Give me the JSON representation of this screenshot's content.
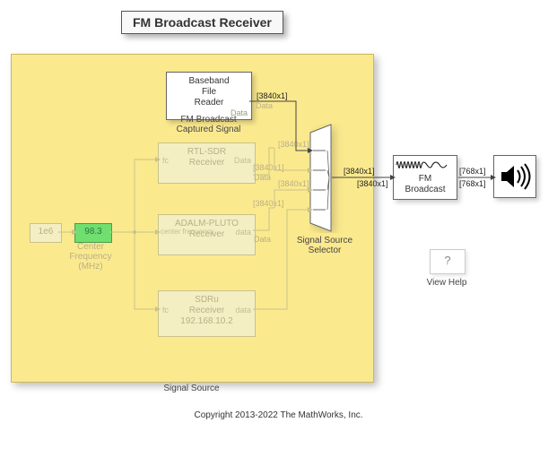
{
  "title": "FM Broadcast Receiver",
  "signal_source": {
    "label": "Signal Source",
    "baseband_reader": {
      "line1": "Baseband",
      "line2": "File",
      "line3": "Reader",
      "out_port": "Data",
      "caption_line1": "FM Broadcast",
      "caption_line2": "Captured Signal",
      "dim": "[3840x1]"
    },
    "const_1e6": "1e6",
    "center_freq_block": "98.3",
    "center_freq_label_line1": "Center",
    "center_freq_label_line2": "Frequency (MHz)",
    "rtl_sdr": {
      "line1": "RTL-SDR",
      "line2": "Receiver",
      "in_port": "fc",
      "out_port": "Data",
      "dim_top": "[3840x1]",
      "dim_bot": "[3840x1]"
    },
    "pluto": {
      "line1": "ADALM-PLUTO",
      "line2": "Receiver",
      "in_port": "center frequency",
      "out_port": "data",
      "dim_top": "[3840x1]",
      "dim_bot": "[3840x1]"
    },
    "sdru": {
      "line1": "SDRu",
      "line2": "Receiver",
      "line3": "192.168.10.2",
      "in_port": "fc",
      "out_port": "data"
    },
    "selector_label_line1": "Signal Source",
    "selector_label_line2": "Selector"
  },
  "outside": {
    "mux_out_top": "[3840x1]",
    "mux_out_bot": "[3840x1]",
    "fm_block_line1": "FM",
    "fm_block_line2": "Broadcast",
    "fm_out_top": "[768x1]",
    "fm_out_bot": "[768x1]",
    "view_help_q": "?",
    "view_help_label": "View Help"
  },
  "copyright": "Copyright 2013-2022 The MathWorks, Inc."
}
